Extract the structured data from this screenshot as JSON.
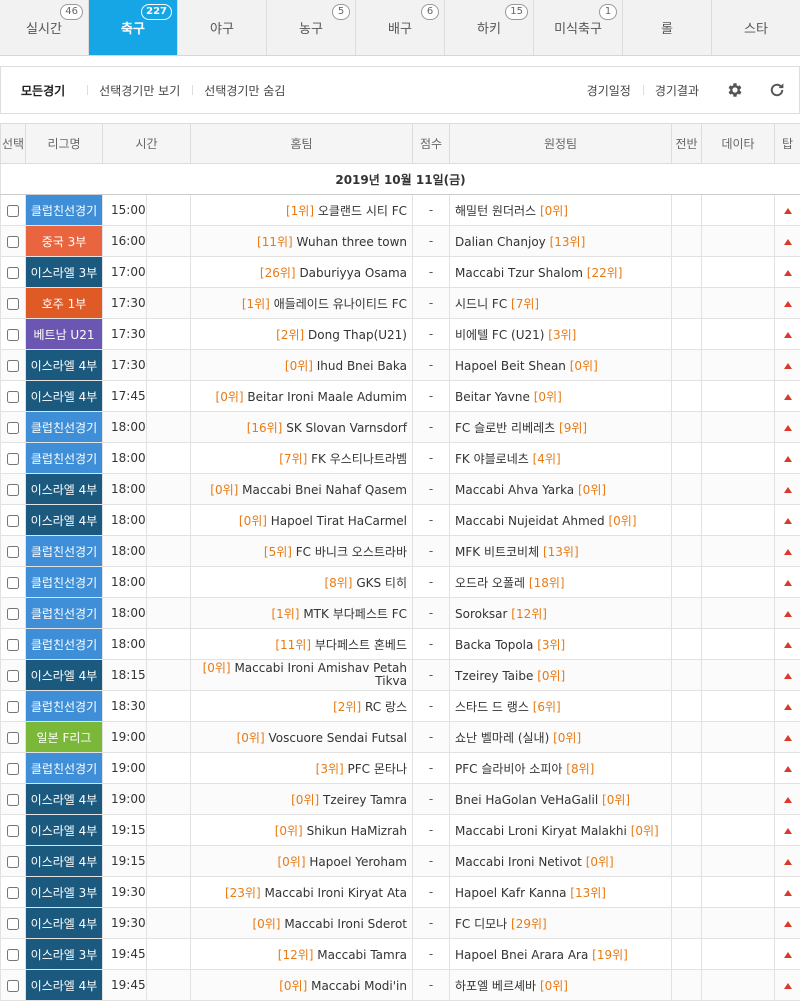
{
  "tabs": [
    {
      "label": "실시간",
      "badge": "46",
      "active": false
    },
    {
      "label": "축구",
      "badge": "227",
      "active": true
    },
    {
      "label": "야구",
      "badge": "",
      "active": false
    },
    {
      "label": "농구",
      "badge": "5",
      "active": false
    },
    {
      "label": "배구",
      "badge": "6",
      "active": false
    },
    {
      "label": "하키",
      "badge": "15",
      "active": false
    },
    {
      "label": "미식축구",
      "badge": "1",
      "active": false
    },
    {
      "label": "롤",
      "badge": "",
      "active": false
    },
    {
      "label": "스타",
      "badge": "",
      "active": false
    }
  ],
  "filter": {
    "all": "모든경기",
    "show_selected": "선택경기만 보기",
    "hide_selected": "선택경기만 숨김",
    "schedule": "경기일정",
    "results": "경기결과",
    "settings_icon": "gear-icon",
    "refresh_icon": "refresh-icon"
  },
  "columns": {
    "select": "선택",
    "league": "리그명",
    "time": "시간",
    "home": "홈팀",
    "score": "점수",
    "away": "원정팀",
    "half": "전반",
    "data": "데이타",
    "tip": "탑"
  },
  "date_label": "2019년 10월 11일(금)",
  "league_colors": {
    "클럽친선경기": "#3f8fd8",
    "중국 3부": "#e8653f",
    "이스라엘 3부": "#1b5a7e",
    "이스라엘 4부": "#1b5a7e",
    "호주 1부": "#e05a26",
    "베트남 U21": "#6b56b2",
    "일본 F리그": "#7bb83a"
  },
  "matches": [
    {
      "league": "클럽친선경기",
      "time": "15:00",
      "home_rank": "[1위]",
      "home": "오클랜드 시티 FC",
      "score": "-",
      "away": "해밀턴 원더러스",
      "away_rank": "[0위]"
    },
    {
      "league": "중국 3부",
      "time": "16:00",
      "home_rank": "[11위]",
      "home": "Wuhan three town",
      "score": "-",
      "away": "Dalian Chanjoy",
      "away_rank": "[13위]"
    },
    {
      "league": "이스라엘 3부",
      "time": "17:00",
      "home_rank": "[26위]",
      "home": "Daburiyya Osama",
      "score": "-",
      "away": "Maccabi Tzur Shalom",
      "away_rank": "[22위]"
    },
    {
      "league": "호주 1부",
      "time": "17:30",
      "home_rank": "[1위]",
      "home": "애들레이드 유나이티드 FC",
      "score": "-",
      "away": "시드니 FC",
      "away_rank": "[7위]"
    },
    {
      "league": "베트남 U21",
      "time": "17:30",
      "home_rank": "[2위]",
      "home": "Dong Thap(U21)",
      "score": "-",
      "away": "비에텔 FC (U21)",
      "away_rank": "[3위]"
    },
    {
      "league": "이스라엘 4부",
      "time": "17:30",
      "home_rank": "[0위]",
      "home": "Ihud Bnei Baka",
      "score": "-",
      "away": "Hapoel Beit Shean",
      "away_rank": "[0위]"
    },
    {
      "league": "이스라엘 4부",
      "time": "17:45",
      "home_rank": "[0위]",
      "home": "Beitar Ironi Maale Adumim",
      "score": "-",
      "away": "Beitar Yavne",
      "away_rank": "[0위]"
    },
    {
      "league": "클럽친선경기",
      "time": "18:00",
      "home_rank": "[16위]",
      "home": "SK Slovan Varnsdorf",
      "score": "-",
      "away": "FC 슬로반 리베레츠",
      "away_rank": "[9위]"
    },
    {
      "league": "클럽친선경기",
      "time": "18:00",
      "home_rank": "[7위]",
      "home": "FK 우스티나트라벰",
      "score": "-",
      "away": "FK 야블로네츠",
      "away_rank": "[4위]"
    },
    {
      "league": "이스라엘 4부",
      "time": "18:00",
      "home_rank": "[0위]",
      "home": "Maccabi Bnei Nahaf Qasem",
      "score": "-",
      "away": "Maccabi Ahva Yarka",
      "away_rank": "[0위]"
    },
    {
      "league": "이스라엘 4부",
      "time": "18:00",
      "home_rank": "[0위]",
      "home": "Hapoel Tirat HaCarmel",
      "score": "-",
      "away": "Maccabi Nujeidat Ahmed",
      "away_rank": "[0위]"
    },
    {
      "league": "클럽친선경기",
      "time": "18:00",
      "home_rank": "[5위]",
      "home": "FC 바니크 오스트라바",
      "score": "-",
      "away": "MFK 비트코비체",
      "away_rank": "[13위]"
    },
    {
      "league": "클럽친선경기",
      "time": "18:00",
      "home_rank": "[8위]",
      "home": "GKS 티히",
      "score": "-",
      "away": "오드라 오폴레",
      "away_rank": "[18위]"
    },
    {
      "league": "클럽친선경기",
      "time": "18:00",
      "home_rank": "[1위]",
      "home": "MTK 부다페스트 FC",
      "score": "-",
      "away": "Soroksar",
      "away_rank": "[12위]"
    },
    {
      "league": "클럽친선경기",
      "time": "18:00",
      "home_rank": "[11위]",
      "home": "부다페스트 혼베드",
      "score": "-",
      "away": "Backa Topola",
      "away_rank": "[3위]"
    },
    {
      "league": "이스라엘 4부",
      "time": "18:15",
      "home_rank": "[0위]",
      "home": "Maccabi Ironi Amishav Petah Tikva",
      "score": "-",
      "away": "Tzeirey Taibe",
      "away_rank": "[0위]"
    },
    {
      "league": "클럽친선경기",
      "time": "18:30",
      "home_rank": "[2위]",
      "home": "RC 랑스",
      "score": "-",
      "away": "스타드 드 랭스",
      "away_rank": "[6위]"
    },
    {
      "league": "일본 F리그",
      "time": "19:00",
      "home_rank": "[0위]",
      "home": "Voscuore Sendai Futsal",
      "score": "-",
      "away": "쇼난 벨마레 (실내)",
      "away_rank": "[0위]"
    },
    {
      "league": "클럽친선경기",
      "time": "19:00",
      "home_rank": "[3위]",
      "home": "PFC 몬타나",
      "score": "-",
      "away": "PFC 슬라비아 소피아",
      "away_rank": "[8위]"
    },
    {
      "league": "이스라엘 4부",
      "time": "19:00",
      "home_rank": "[0위]",
      "home": "Tzeirey Tamra",
      "score": "-",
      "away": "Bnei HaGolan VeHaGalil",
      "away_rank": "[0위]"
    },
    {
      "league": "이스라엘 4부",
      "time": "19:15",
      "home_rank": "[0위]",
      "home": "Shikun HaMizrah",
      "score": "-",
      "away": "Maccabi Lroni Kiryat Malakhi",
      "away_rank": "[0위]"
    },
    {
      "league": "이스라엘 4부",
      "time": "19:15",
      "home_rank": "[0위]",
      "home": "Hapoel Yeroham",
      "score": "-",
      "away": "Maccabi Ironi Netivot",
      "away_rank": "[0위]"
    },
    {
      "league": "이스라엘 3부",
      "time": "19:30",
      "home_rank": "[23위]",
      "home": "Maccabi Ironi Kiryat Ata",
      "score": "-",
      "away": "Hapoel Kafr Kanna",
      "away_rank": "[13위]"
    },
    {
      "league": "이스라엘 4부",
      "time": "19:30",
      "home_rank": "[0위]",
      "home": "Maccabi Ironi Sderot",
      "score": "-",
      "away": "FC 디모나",
      "away_rank": "[29위]"
    },
    {
      "league": "이스라엘 3부",
      "time": "19:45",
      "home_rank": "[12위]",
      "home": "Maccabi Tamra",
      "score": "-",
      "away": "Hapoel Bnei Arara Ara",
      "away_rank": "[19위]"
    },
    {
      "league": "이스라엘 4부",
      "time": "19:45",
      "home_rank": "[0위]",
      "home": "Maccabi Modi'in",
      "score": "-",
      "away": "하포엘 베르셰바",
      "away_rank": "[0위]"
    }
  ]
}
